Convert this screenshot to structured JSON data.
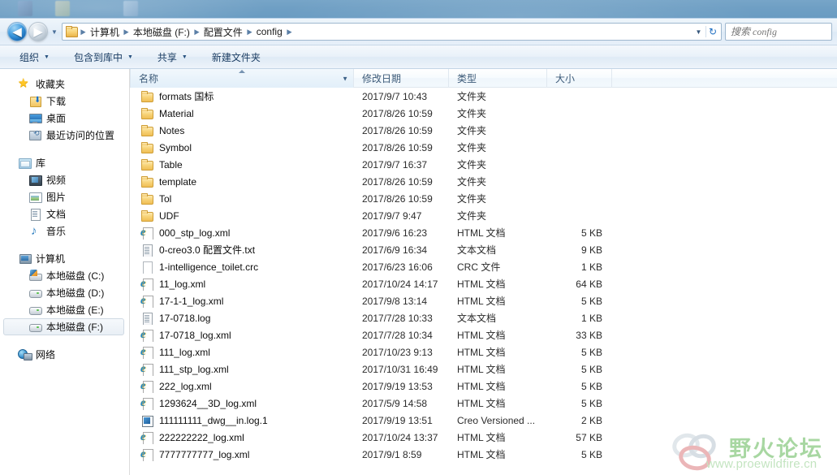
{
  "window": {
    "desktop_icons": [
      "desktop-icon-1",
      "desktop-icon-2",
      "desktop-icon-3"
    ]
  },
  "nav": {
    "back_label": "◀",
    "back_name": "back-button",
    "forward_label": "▶",
    "forward_name": "forward-button",
    "history_caret": "▼",
    "address_caret": "▼",
    "refresh_glyph": "↻",
    "breadcrumbs": [
      {
        "label": "计算机"
      },
      {
        "label": "本地磁盘 (F:)"
      },
      {
        "label": "配置文件"
      },
      {
        "label": "config"
      }
    ],
    "crumb_separator": "▶"
  },
  "search": {
    "placeholder": "搜索 config",
    "value": ""
  },
  "toolbar": {
    "items": [
      {
        "label": "组织",
        "caret": "▼",
        "name": "toolbar-organize"
      },
      {
        "label": "包含到库中",
        "caret": "▼",
        "name": "toolbar-include-in-library"
      },
      {
        "label": "共享",
        "caret": "▼",
        "name": "toolbar-share"
      },
      {
        "label": "新建文件夹",
        "caret": "",
        "name": "toolbar-new-folder"
      }
    ]
  },
  "sidebar": {
    "groups": [
      {
        "header": {
          "label": "收藏夹",
          "icon": "star-icon",
          "name": "sidebar-group-favorites"
        },
        "items": [
          {
            "label": "下载",
            "icon": "download-icon",
            "name": "sidebar-item-downloads"
          },
          {
            "label": "桌面",
            "icon": "desktop-icon",
            "name": "sidebar-item-desktop"
          },
          {
            "label": "最近访问的位置",
            "icon": "recent-places-icon",
            "name": "sidebar-item-recent-places"
          }
        ]
      },
      {
        "header": {
          "label": "库",
          "icon": "library-icon",
          "name": "sidebar-group-libraries"
        },
        "items": [
          {
            "label": "视频",
            "icon": "video-icon",
            "name": "sidebar-item-videos"
          },
          {
            "label": "图片",
            "icon": "picture-icon",
            "name": "sidebar-item-pictures"
          },
          {
            "label": "文档",
            "icon": "document-icon",
            "name": "sidebar-item-documents"
          },
          {
            "label": "音乐",
            "icon": "music-icon",
            "name": "sidebar-item-music"
          }
        ]
      },
      {
        "header": {
          "label": "计算机",
          "icon": "computer-icon",
          "name": "sidebar-group-computer"
        },
        "items": [
          {
            "label": "本地磁盘 (C:)",
            "icon": "system-drive-icon",
            "name": "sidebar-item-drive-c",
            "selected": false
          },
          {
            "label": "本地磁盘 (D:)",
            "icon": "drive-icon",
            "name": "sidebar-item-drive-d",
            "selected": false
          },
          {
            "label": "本地磁盘 (E:)",
            "icon": "drive-icon",
            "name": "sidebar-item-drive-e",
            "selected": false
          },
          {
            "label": "本地磁盘 (F:)",
            "icon": "drive-icon",
            "name": "sidebar-item-drive-f",
            "selected": true
          }
        ]
      },
      {
        "header": {
          "label": "网络",
          "icon": "network-icon",
          "name": "sidebar-group-network"
        },
        "items": []
      }
    ]
  },
  "filelist": {
    "columns": [
      {
        "label": "名称",
        "key": "name",
        "sorted": true,
        "sort_dir": "asc",
        "has_menu": true
      },
      {
        "label": "修改日期",
        "key": "date",
        "sorted": false
      },
      {
        "label": "类型",
        "key": "type",
        "sorted": false
      },
      {
        "label": "大小",
        "key": "size",
        "sorted": false
      }
    ],
    "rows": [
      {
        "name": "formats 国标",
        "date": "2017/9/7 10:43",
        "type": "文件夹",
        "size": "",
        "icon": "folder-icon"
      },
      {
        "name": "Material",
        "date": "2017/8/26 10:59",
        "type": "文件夹",
        "size": "",
        "icon": "folder-icon"
      },
      {
        "name": "Notes",
        "date": "2017/8/26 10:59",
        "type": "文件夹",
        "size": "",
        "icon": "folder-icon"
      },
      {
        "name": "Symbol",
        "date": "2017/8/26 10:59",
        "type": "文件夹",
        "size": "",
        "icon": "folder-icon"
      },
      {
        "name": "Table",
        "date": "2017/9/7 16:37",
        "type": "文件夹",
        "size": "",
        "icon": "folder-icon"
      },
      {
        "name": "template",
        "date": "2017/8/26 10:59",
        "type": "文件夹",
        "size": "",
        "icon": "folder-icon"
      },
      {
        "name": "Tol",
        "date": "2017/8/26 10:59",
        "type": "文件夹",
        "size": "",
        "icon": "folder-icon"
      },
      {
        "name": "UDF",
        "date": "2017/9/7 9:47",
        "type": "文件夹",
        "size": "",
        "icon": "folder-icon"
      },
      {
        "name": "000_stp_log.xml",
        "date": "2017/9/6 16:23",
        "type": "HTML 文档",
        "size": "5 KB",
        "icon": "ie-html-icon"
      },
      {
        "name": "0-creo3.0 配置文件.txt",
        "date": "2017/6/9 16:34",
        "type": "文本文档",
        "size": "9 KB",
        "icon": "text-file-icon"
      },
      {
        "name": "1-intelligence_toilet.crc",
        "date": "2017/6/23 16:06",
        "type": "CRC 文件",
        "size": "1 KB",
        "icon": "blank-file-icon"
      },
      {
        "name": "11_log.xml",
        "date": "2017/10/24 14:17",
        "type": "HTML 文档",
        "size": "64 KB",
        "icon": "ie-html-icon"
      },
      {
        "name": "17-1-1_log.xml",
        "date": "2017/9/8 13:14",
        "type": "HTML 文档",
        "size": "5 KB",
        "icon": "ie-html-icon"
      },
      {
        "name": "17-0718.log",
        "date": "2017/7/28 10:33",
        "type": "文本文档",
        "size": "1 KB",
        "icon": "text-file-icon"
      },
      {
        "name": "17-0718_log.xml",
        "date": "2017/7/28 10:34",
        "type": "HTML 文档",
        "size": "33 KB",
        "icon": "ie-html-icon"
      },
      {
        "name": "111_log.xml",
        "date": "2017/10/23 9:13",
        "type": "HTML 文档",
        "size": "5 KB",
        "icon": "ie-html-icon"
      },
      {
        "name": "111_stp_log.xml",
        "date": "2017/10/31 16:49",
        "type": "HTML 文档",
        "size": "5 KB",
        "icon": "ie-html-icon"
      },
      {
        "name": "222_log.xml",
        "date": "2017/9/19 13:53",
        "type": "HTML 文档",
        "size": "5 KB",
        "icon": "ie-html-icon"
      },
      {
        "name": "1293624__3D_log.xml",
        "date": "2017/5/9 14:58",
        "type": "HTML 文档",
        "size": "5 KB",
        "icon": "ie-html-icon"
      },
      {
        "name": "111111111_dwg__in.log.1",
        "date": "2017/9/19 13:51",
        "type": "Creo Versioned ...",
        "size": "2 KB",
        "icon": "creo-file-icon"
      },
      {
        "name": "222222222_log.xml",
        "date": "2017/10/24 13:37",
        "type": "HTML 文档",
        "size": "57 KB",
        "icon": "ie-html-icon"
      },
      {
        "name": "7777777777_log.xml",
        "date": "2017/9/1 8:59",
        "type": "HTML 文档",
        "size": "5 KB",
        "icon": "ie-html-icon"
      }
    ]
  },
  "watermark": {
    "title": "野火论坛",
    "url": "www.proewildfire.cn"
  },
  "colors": {
    "accent": "#1c6cc0",
    "folder": "#f8d479",
    "selection": "#e9eff5",
    "watermark_green": "#74c06a",
    "desktop": "#6f9fc4"
  }
}
